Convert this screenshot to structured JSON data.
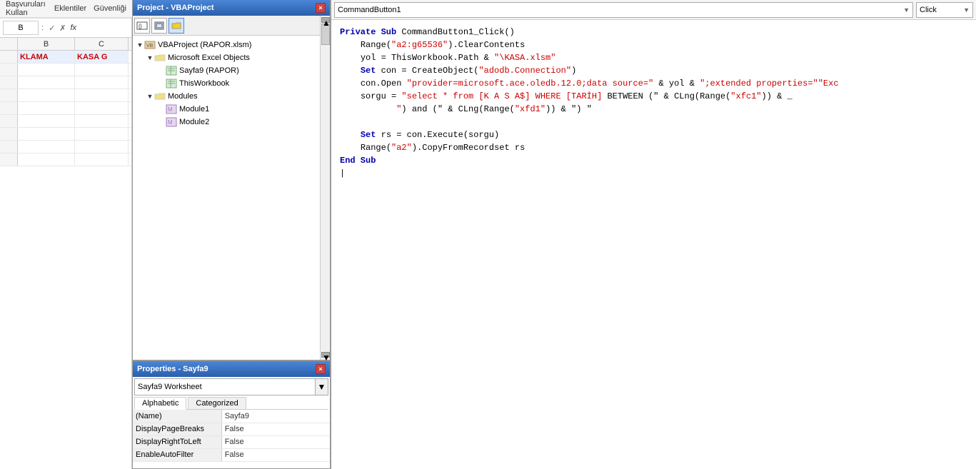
{
  "excel_panel": {
    "menu_items": [
      "Başvuruları Kullan",
      "Eklentiler",
      "Güvenliği"
    ],
    "formula_bar": {
      "cell_ref": "B",
      "formula_icon": "f(x)",
      "value": ""
    },
    "columns": [
      "B",
      "C"
    ],
    "header_labels": [
      "KLAMA",
      "KASA G"
    ]
  },
  "project_panel": {
    "title": "Project - VBAProject",
    "close_btn": "×",
    "toolbar_btns": [
      "⊞",
      "⊟",
      "📁"
    ],
    "tree": {
      "root": {
        "icon": "🗄",
        "label": "VBAProject (RAPOR.xlsm)",
        "children": [
          {
            "icon": "📁",
            "label": "Microsoft Excel Objects",
            "children": [
              {
                "icon": "📋",
                "label": "Sayfa9 (RAPOR)"
              },
              {
                "icon": "📋",
                "label": "ThisWorkbook"
              }
            ]
          },
          {
            "icon": "📁",
            "label": "Modules",
            "children": [
              {
                "icon": "📄",
                "label": "Module1"
              },
              {
                "icon": "📄",
                "label": "Module2"
              }
            ]
          }
        ]
      }
    }
  },
  "properties_panel": {
    "title": "Properties - Sayfa9",
    "close_btn": "×",
    "dropdown_text": "Sayfa9 Worksheet",
    "tabs": [
      "Alphabetic",
      "Categorized"
    ],
    "active_tab": "Alphabetic",
    "properties": [
      {
        "name": "(Name)",
        "value": "Sayfa9"
      },
      {
        "name": "DisplayPageBreaks",
        "value": "False"
      },
      {
        "name": "DisplayRightToLeft",
        "value": "False"
      },
      {
        "name": "EnableAutoFilter",
        "value": "False"
      }
    ]
  },
  "code_editor": {
    "object_dropdown": "CommandButton1",
    "event_dropdown": "Click",
    "code_lines": [
      {
        "indent": "",
        "tokens": [
          {
            "type": "kw",
            "text": "Private Sub "
          },
          {
            "type": "fn",
            "text": "CommandButton1_Click()"
          }
        ]
      },
      {
        "indent": "    ",
        "tokens": [
          {
            "type": "fn",
            "text": "Range("
          },
          {
            "type": "str",
            "text": "\"a2:g65536\""
          },
          {
            "type": "fn",
            "text": ").ClearContents"
          }
        ]
      },
      {
        "indent": "    ",
        "tokens": [
          {
            "type": "fn",
            "text": "yol = ThisWorkbook.Path & "
          },
          {
            "type": "str",
            "text": "\"\\KASA.xlsm\""
          }
        ]
      },
      {
        "indent": "    ",
        "tokens": [
          {
            "type": "kw",
            "text": "Set "
          },
          {
            "type": "fn",
            "text": "con = CreateObject("
          },
          {
            "type": "str",
            "text": "\"adodb.Connection\""
          },
          {
            "type": "fn",
            "text": ")"
          }
        ]
      },
      {
        "indent": "    ",
        "tokens": [
          {
            "type": "fn",
            "text": "con.Open "
          },
          {
            "type": "str",
            "text": "\"provider=microsoft.ace.oledb.12.0;data source=\""
          },
          {
            "type": "fn",
            "text": " & yol & "
          },
          {
            "type": "str",
            "text": "\";extended properties=\"\"Exc"
          }
        ]
      },
      {
        "indent": "    ",
        "tokens": [
          {
            "type": "fn",
            "text": "sorgu = "
          },
          {
            "type": "str",
            "text": "\"select * from [K A S A$] WHERE [TARİH] "
          },
          {
            "type": "fn",
            "text": "BETWEEN (\" & CLng(Range("
          },
          {
            "type": "str",
            "text": "\"xfc1\""
          },
          {
            "type": "fn",
            "text": ")) & _"
          }
        ]
      },
      {
        "indent": "    ",
        "tokens": [
          {
            "type": "str",
            "text": "           \""
          },
          {
            "type": "fn",
            "text": ") and (\" & CLng(Range("
          },
          {
            "type": "str",
            "text": "\"xfd1\""
          },
          {
            "type": "fn",
            "text": ")) & \") \""
          }
        ]
      },
      {
        "indent": "",
        "tokens": [
          {
            "type": "plain",
            "text": ""
          }
        ]
      },
      {
        "indent": "    ",
        "tokens": [
          {
            "type": "kw",
            "text": "Set "
          },
          {
            "type": "fn",
            "text": "rs = con.Execute(sorgu)"
          }
        ]
      },
      {
        "indent": "    ",
        "tokens": [
          {
            "type": "fn",
            "text": "Range("
          },
          {
            "type": "str",
            "text": "\"a2\""
          },
          {
            "type": "fn",
            "text": ").CopyFromRecordset rs"
          }
        ]
      },
      {
        "indent": "",
        "tokens": [
          {
            "type": "kw",
            "text": "End Sub"
          }
        ]
      },
      {
        "indent": "",
        "tokens": [
          {
            "type": "plain",
            "text": "|"
          }
        ]
      }
    ]
  }
}
